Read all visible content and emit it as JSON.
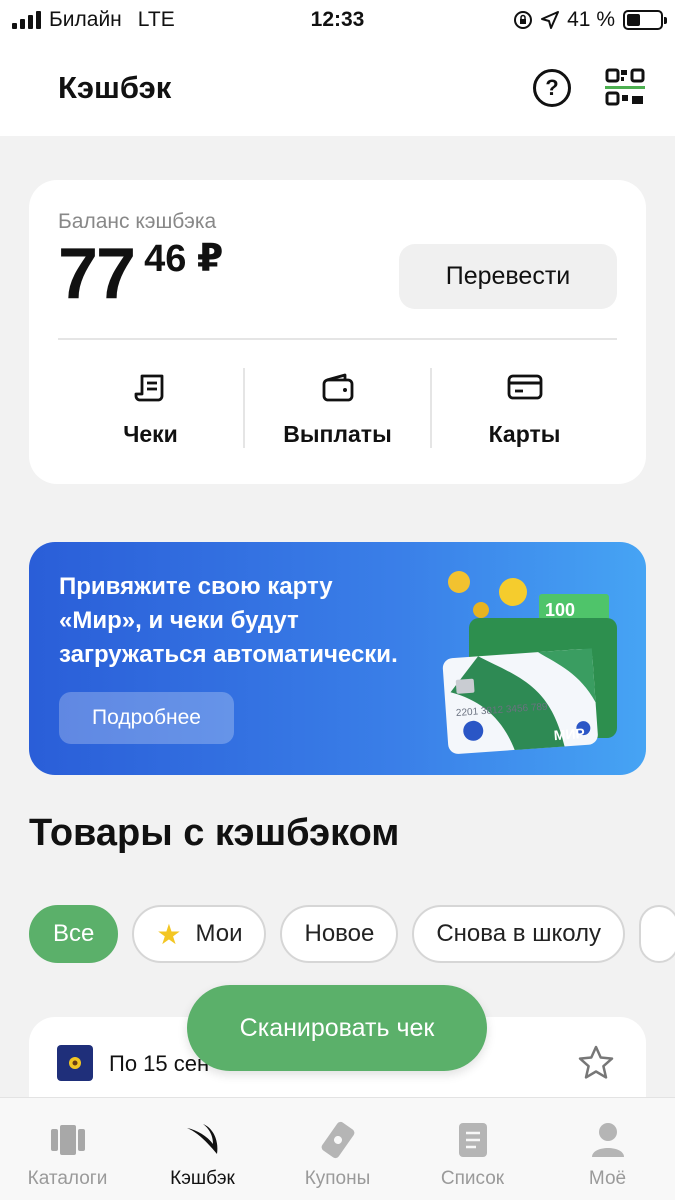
{
  "status_bar": {
    "carrier": "Билайн",
    "network": "LTE",
    "time": "12:33",
    "battery_percent": "41 %",
    "battery_level": 0.41
  },
  "header": {
    "title": "Кэшбэк",
    "help_icon": "question-circle-icon",
    "qr_icon": "qr-scan-icon"
  },
  "balance": {
    "label": "Баланс кэшбэка",
    "amount_int": "77",
    "amount_frac": "46 ₽",
    "transfer_label": "Перевести",
    "actions": [
      {
        "label": "Чеки",
        "icon": "receipt-icon"
      },
      {
        "label": "Выплаты",
        "icon": "wallet-icon"
      },
      {
        "label": "Карты",
        "icon": "card-icon"
      }
    ]
  },
  "banner": {
    "line1": "Привяжите свою карту",
    "line2": "«Мир», и чеки будут",
    "line3": "загружаться  автоматически.",
    "button_label": "Подробнее",
    "card_brand": "МИР",
    "bill_value": "100",
    "card_number": "2201  3812  3456  789",
    "colors": {
      "gradient_start": "#2a5ed8",
      "gradient_end": "#46a4f4"
    }
  },
  "goods": {
    "title": "Товары с кэшбэком",
    "chips": [
      {
        "label": "Все",
        "active": true
      },
      {
        "label": "Мои",
        "icon": "star-icon"
      },
      {
        "label": "Новое"
      },
      {
        "label": "Снова в школу"
      }
    ],
    "first_item_date": "По 15 сен"
  },
  "scan_button": {
    "label": "Сканировать чек"
  },
  "tabbar": {
    "tabs": [
      {
        "label": "Каталоги",
        "icon": "catalog-icon"
      },
      {
        "label": "Кэшбэк",
        "icon": "cashback-icon",
        "active": true
      },
      {
        "label": "Купоны",
        "icon": "coupon-icon"
      },
      {
        "label": "Список",
        "icon": "list-icon"
      },
      {
        "label": "Моё",
        "icon": "profile-icon"
      }
    ]
  },
  "colors": {
    "accent_green": "#5bb06a",
    "background": "#f2f2f2"
  }
}
